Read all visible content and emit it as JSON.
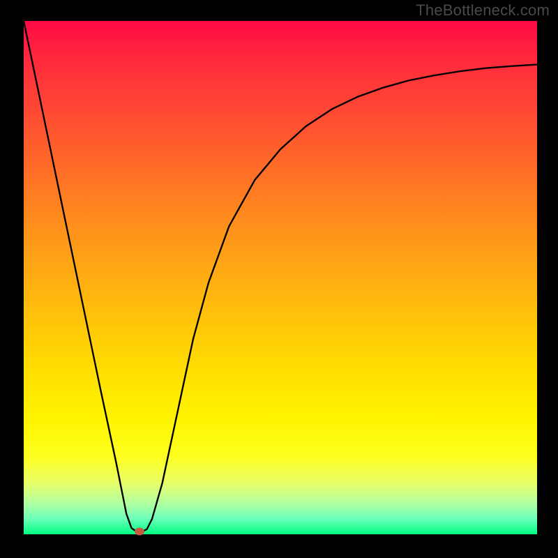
{
  "attribution": "TheBottleneck.com",
  "chart_data": {
    "type": "line",
    "title": "",
    "xlabel": "",
    "ylabel": "",
    "xlim": [
      0,
      100
    ],
    "ylim": [
      0,
      100
    ],
    "series": [
      {
        "name": "curve",
        "x": [
          0,
          5,
          10,
          15,
          18,
          20,
          21,
          22,
          23,
          24,
          25,
          27,
          30,
          33,
          36,
          40,
          45,
          50,
          55,
          60,
          65,
          70,
          75,
          80,
          85,
          90,
          95,
          100
        ],
        "y": [
          100,
          76,
          52,
          28,
          14,
          4,
          1.2,
          0.5,
          0.5,
          1.0,
          3,
          10,
          24,
          38,
          49,
          60,
          69,
          75,
          79.5,
          82.8,
          85.2,
          87,
          88.4,
          89.4,
          90.2,
          90.8,
          91.2,
          91.5
        ]
      }
    ],
    "marker": {
      "x": 22.5,
      "y": 0.5
    },
    "background": {
      "gradient_stops": [
        {
          "pos": 0,
          "color": "#ff0a45"
        },
        {
          "pos": 50,
          "color": "#ffa714"
        },
        {
          "pos": 80,
          "color": "#fff500"
        },
        {
          "pos": 100,
          "color": "#00ff80"
        }
      ]
    }
  }
}
